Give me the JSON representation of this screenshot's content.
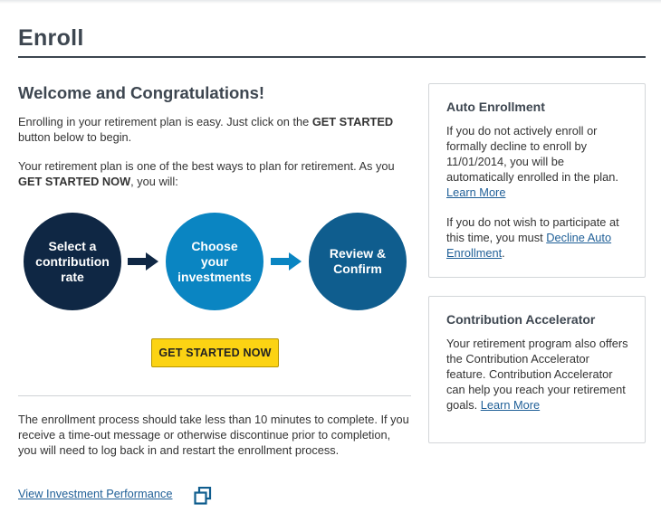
{
  "page": {
    "title": "Enroll"
  },
  "welcome": {
    "heading": "Welcome and Congratulations!",
    "p1_a": "Enrolling in your retirement plan is easy. Just click on the ",
    "p1_b": "GET STARTED",
    "p1_c": " button below to begin.",
    "p2_a": "Your retirement plan is one of the best ways to plan for retirement. As you ",
    "p2_b": "GET STARTED NOW",
    "p2_c": ", you will:"
  },
  "steps": [
    {
      "label_lines": [
        "Select a",
        "contribution",
        "rate"
      ],
      "color": "#0f2744"
    },
    {
      "label_lines": [
        "Choose",
        "your",
        "investments"
      ],
      "color": "#0a85c2"
    },
    {
      "label_lines": [
        "Review &",
        "Confirm"
      ],
      "color": "#0f5d8e"
    }
  ],
  "cta": {
    "label": "GET STARTED NOW",
    "color": "#fcd313"
  },
  "footer": {
    "note": "The enrollment process should take less than 10 minutes to complete. If you receive a time-out message or otherwise discontinue prior to completion, you will need to log back in and restart the enrollment process.",
    "performance_link": "View Investment Performance",
    "performance_icon": "new-window-icon"
  },
  "auto_enrollment": {
    "title": "Auto Enrollment",
    "text1": "If you do not actively enroll or formally decline to enroll by 11/01/2014, you will be automatically enrolled in the plan. ",
    "learn_more": "Learn More",
    "text2": "If you do not wish to participate at this time, you must ",
    "decline_link": "Decline Auto Enrollment",
    "text2_end": "."
  },
  "accelerator": {
    "title": "Contribution Accelerator",
    "text": "Your retirement program also offers the Contribution Accelerator feature. Contribution Accelerator can help you reach your retirement goals. ",
    "learn_more": "Learn More"
  },
  "colors": {
    "link": "#1f5f97",
    "heading": "#3d4650"
  }
}
